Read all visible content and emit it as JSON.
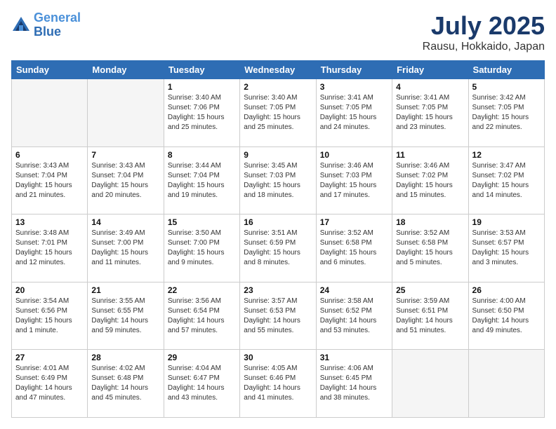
{
  "header": {
    "logo_line1": "General",
    "logo_line2": "Blue",
    "month": "July 2025",
    "location": "Rausu, Hokkaido, Japan"
  },
  "weekdays": [
    "Sunday",
    "Monday",
    "Tuesday",
    "Wednesday",
    "Thursday",
    "Friday",
    "Saturday"
  ],
  "weeks": [
    [
      {
        "day": "",
        "sunrise": "",
        "sunset": "",
        "daylight": ""
      },
      {
        "day": "",
        "sunrise": "",
        "sunset": "",
        "daylight": ""
      },
      {
        "day": "1",
        "sunrise": "Sunrise: 3:40 AM",
        "sunset": "Sunset: 7:06 PM",
        "daylight": "Daylight: 15 hours and 25 minutes."
      },
      {
        "day": "2",
        "sunrise": "Sunrise: 3:40 AM",
        "sunset": "Sunset: 7:05 PM",
        "daylight": "Daylight: 15 hours and 25 minutes."
      },
      {
        "day": "3",
        "sunrise": "Sunrise: 3:41 AM",
        "sunset": "Sunset: 7:05 PM",
        "daylight": "Daylight: 15 hours and 24 minutes."
      },
      {
        "day": "4",
        "sunrise": "Sunrise: 3:41 AM",
        "sunset": "Sunset: 7:05 PM",
        "daylight": "Daylight: 15 hours and 23 minutes."
      },
      {
        "day": "5",
        "sunrise": "Sunrise: 3:42 AM",
        "sunset": "Sunset: 7:05 PM",
        "daylight": "Daylight: 15 hours and 22 minutes."
      }
    ],
    [
      {
        "day": "6",
        "sunrise": "Sunrise: 3:43 AM",
        "sunset": "Sunset: 7:04 PM",
        "daylight": "Daylight: 15 hours and 21 minutes."
      },
      {
        "day": "7",
        "sunrise": "Sunrise: 3:43 AM",
        "sunset": "Sunset: 7:04 PM",
        "daylight": "Daylight: 15 hours and 20 minutes."
      },
      {
        "day": "8",
        "sunrise": "Sunrise: 3:44 AM",
        "sunset": "Sunset: 7:04 PM",
        "daylight": "Daylight: 15 hours and 19 minutes."
      },
      {
        "day": "9",
        "sunrise": "Sunrise: 3:45 AM",
        "sunset": "Sunset: 7:03 PM",
        "daylight": "Daylight: 15 hours and 18 minutes."
      },
      {
        "day": "10",
        "sunrise": "Sunrise: 3:46 AM",
        "sunset": "Sunset: 7:03 PM",
        "daylight": "Daylight: 15 hours and 17 minutes."
      },
      {
        "day": "11",
        "sunrise": "Sunrise: 3:46 AM",
        "sunset": "Sunset: 7:02 PM",
        "daylight": "Daylight: 15 hours and 15 minutes."
      },
      {
        "day": "12",
        "sunrise": "Sunrise: 3:47 AM",
        "sunset": "Sunset: 7:02 PM",
        "daylight": "Daylight: 15 hours and 14 minutes."
      }
    ],
    [
      {
        "day": "13",
        "sunrise": "Sunrise: 3:48 AM",
        "sunset": "Sunset: 7:01 PM",
        "daylight": "Daylight: 15 hours and 12 minutes."
      },
      {
        "day": "14",
        "sunrise": "Sunrise: 3:49 AM",
        "sunset": "Sunset: 7:00 PM",
        "daylight": "Daylight: 15 hours and 11 minutes."
      },
      {
        "day": "15",
        "sunrise": "Sunrise: 3:50 AM",
        "sunset": "Sunset: 7:00 PM",
        "daylight": "Daylight: 15 hours and 9 minutes."
      },
      {
        "day": "16",
        "sunrise": "Sunrise: 3:51 AM",
        "sunset": "Sunset: 6:59 PM",
        "daylight": "Daylight: 15 hours and 8 minutes."
      },
      {
        "day": "17",
        "sunrise": "Sunrise: 3:52 AM",
        "sunset": "Sunset: 6:58 PM",
        "daylight": "Daylight: 15 hours and 6 minutes."
      },
      {
        "day": "18",
        "sunrise": "Sunrise: 3:52 AM",
        "sunset": "Sunset: 6:58 PM",
        "daylight": "Daylight: 15 hours and 5 minutes."
      },
      {
        "day": "19",
        "sunrise": "Sunrise: 3:53 AM",
        "sunset": "Sunset: 6:57 PM",
        "daylight": "Daylight: 15 hours and 3 minutes."
      }
    ],
    [
      {
        "day": "20",
        "sunrise": "Sunrise: 3:54 AM",
        "sunset": "Sunset: 6:56 PM",
        "daylight": "Daylight: 15 hours and 1 minute."
      },
      {
        "day": "21",
        "sunrise": "Sunrise: 3:55 AM",
        "sunset": "Sunset: 6:55 PM",
        "daylight": "Daylight: 14 hours and 59 minutes."
      },
      {
        "day": "22",
        "sunrise": "Sunrise: 3:56 AM",
        "sunset": "Sunset: 6:54 PM",
        "daylight": "Daylight: 14 hours and 57 minutes."
      },
      {
        "day": "23",
        "sunrise": "Sunrise: 3:57 AM",
        "sunset": "Sunset: 6:53 PM",
        "daylight": "Daylight: 14 hours and 55 minutes."
      },
      {
        "day": "24",
        "sunrise": "Sunrise: 3:58 AM",
        "sunset": "Sunset: 6:52 PM",
        "daylight": "Daylight: 14 hours and 53 minutes."
      },
      {
        "day": "25",
        "sunrise": "Sunrise: 3:59 AM",
        "sunset": "Sunset: 6:51 PM",
        "daylight": "Daylight: 14 hours and 51 minutes."
      },
      {
        "day": "26",
        "sunrise": "Sunrise: 4:00 AM",
        "sunset": "Sunset: 6:50 PM",
        "daylight": "Daylight: 14 hours and 49 minutes."
      }
    ],
    [
      {
        "day": "27",
        "sunrise": "Sunrise: 4:01 AM",
        "sunset": "Sunset: 6:49 PM",
        "daylight": "Daylight: 14 hours and 47 minutes."
      },
      {
        "day": "28",
        "sunrise": "Sunrise: 4:02 AM",
        "sunset": "Sunset: 6:48 PM",
        "daylight": "Daylight: 14 hours and 45 minutes."
      },
      {
        "day": "29",
        "sunrise": "Sunrise: 4:04 AM",
        "sunset": "Sunset: 6:47 PM",
        "daylight": "Daylight: 14 hours and 43 minutes."
      },
      {
        "day": "30",
        "sunrise": "Sunrise: 4:05 AM",
        "sunset": "Sunset: 6:46 PM",
        "daylight": "Daylight: 14 hours and 41 minutes."
      },
      {
        "day": "31",
        "sunrise": "Sunrise: 4:06 AM",
        "sunset": "Sunset: 6:45 PM",
        "daylight": "Daylight: 14 hours and 38 minutes."
      },
      {
        "day": "",
        "sunrise": "",
        "sunset": "",
        "daylight": ""
      },
      {
        "day": "",
        "sunrise": "",
        "sunset": "",
        "daylight": ""
      }
    ]
  ]
}
